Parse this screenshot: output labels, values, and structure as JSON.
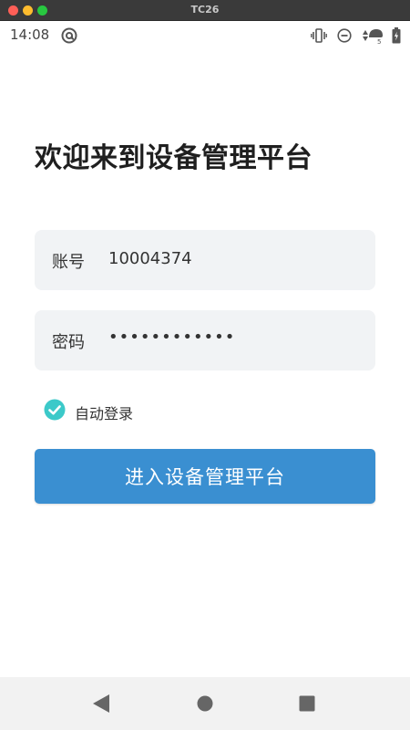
{
  "window": {
    "title": "TC26"
  },
  "status_bar": {
    "time": "14:08",
    "icons": [
      "at-sign-icon",
      "vibrate-icon",
      "do-not-disturb-icon",
      "mobile-data-icon",
      "battery-charging-icon"
    ],
    "data_label": "5"
  },
  "login": {
    "welcome": "欢迎来到设备管理平台",
    "account_label": "账号",
    "account_value": "10004374",
    "password_label": "密码",
    "password_masked": "••••••••••••",
    "auto_login_label": "自动登录",
    "auto_login_checked": true,
    "enter_button": "进入设备管理平台"
  },
  "colors": {
    "primary_button": "#3a8fd1",
    "checkbox": "#3cc9c9",
    "field_background": "#f1f3f5"
  },
  "nav_bar": {
    "icons": [
      "back-icon",
      "home-icon",
      "recents-icon"
    ]
  }
}
